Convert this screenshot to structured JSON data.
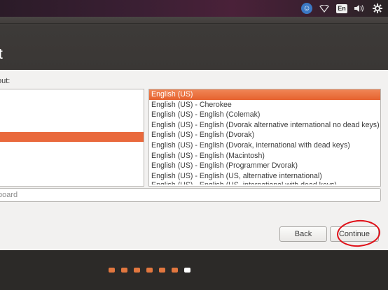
{
  "panel": {
    "icons": [
      "accessibility-icon",
      "wifi-icon",
      "language-indicator",
      "volume-icon",
      "settings-gear-icon"
    ],
    "language_label": "En"
  },
  "window": {
    "title_fragment": "t"
  },
  "layout_prompt": "out:",
  "variants": {
    "selected": "English (US)",
    "items": [
      "English (US)",
      "English (US) - Cherokee",
      "English (US) - English (Colemak)",
      "English (US) - English (Dvorak alternative international no dead keys)",
      "English (US) - English (Dvorak)",
      "English (US) - English (Dvorak, international with dead keys)",
      "English (US) - English (Macintosh)",
      "English (US) - English (Programmer Dvorak)",
      "English (US) - English (US, alternative international)",
      "English (US) - English (US, international with dead keys)"
    ]
  },
  "test_field": {
    "placeholder": "board"
  },
  "buttons": {
    "back": "Back",
    "continue": "Continue"
  },
  "progress": {
    "total_steps": 7,
    "current_step": 7
  },
  "colors": {
    "accent": "#e9693c",
    "annotation_ring": "#e01018"
  }
}
